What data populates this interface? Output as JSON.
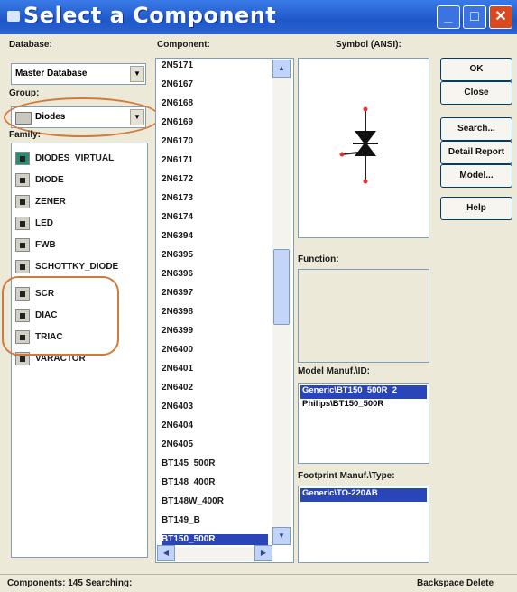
{
  "window": {
    "title": "Select a Component"
  },
  "database": {
    "label": "Database:",
    "value": "Master Database"
  },
  "group": {
    "label": "Group:",
    "value": "Diodes"
  },
  "family": {
    "label": "Family:",
    "items": [
      "DIODES_VIRTUAL",
      "DIODE",
      "ZENER",
      "LED",
      "FWB",
      "SCHOTTKY_DIODE",
      "SCR",
      "DIAC",
      "TRIAC",
      "VARACTOR"
    ]
  },
  "component": {
    "label": "Component:",
    "items": [
      "2N5171",
      "2N6167",
      "2N6168",
      "2N6169",
      "2N6170",
      "2N6171",
      "2N6172",
      "2N6173",
      "2N6174",
      "2N6394",
      "2N6395",
      "2N6396",
      "2N6397",
      "2N6398",
      "2N6399",
      "2N6400",
      "2N6401",
      "2N6402",
      "2N6403",
      "2N6404",
      "2N6405",
      "BT145_500R",
      "BT148_400R",
      "BT148W_400R",
      "BT149_B",
      "BT150_500R"
    ]
  },
  "symbol": {
    "label": "Symbol (ANSI):"
  },
  "function": {
    "label": "Function:"
  },
  "model": {
    "label": "Model Manuf.\\ID:",
    "items": [
      "Generic\\BT150_500R_2",
      "Philips\\BT150_500R"
    ]
  },
  "footprint": {
    "label": "Footprint Manuf.\\Type:",
    "items": [
      "Generic\\TO-220AB"
    ]
  },
  "buttons": {
    "ok": "OK",
    "close": "Close",
    "search": "Search...",
    "detail": "Detail Report",
    "model": "Model...",
    "help": "Help"
  },
  "status": {
    "left": "Components: 145 Searching:",
    "right": "Backspace Delete"
  },
  "colors": {
    "title_bar": "#1f57c8",
    "highlight": "#2a45b8",
    "annotation_ring": "#d27a3a"
  }
}
